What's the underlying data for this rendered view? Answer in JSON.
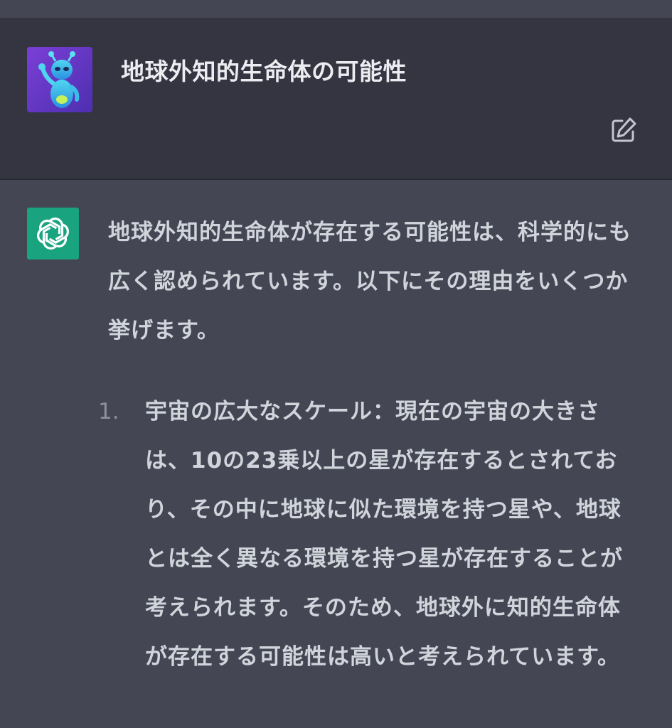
{
  "user_message": {
    "text": "地球外知的生命体の可能性",
    "avatar": "alien-avatar",
    "edit_icon": "edit-icon"
  },
  "assistant_message": {
    "logo": "openai-logo-icon",
    "intro": "地球外知的生命体が存在する可能性は、科学的にも広く認められています。以下にその理由をいくつか挙げます。",
    "list_items": [
      {
        "number": "1.",
        "text": "宇宙の広大なスケール：現在の宇宙の大きさは、10の23乗以上の星が存在するとされており、その中に地球に似た環境を持つ星や、地球とは全く異なる環境を持つ星が存在することが考えられます。そのため、地球外に知的生命体が存在する可能性は高いと考えられています。"
      }
    ]
  },
  "colors": {
    "user_bg": "#343541",
    "assistant_bg": "#444654",
    "logo_green": "#19a37f",
    "text": "#d1d5db"
  }
}
